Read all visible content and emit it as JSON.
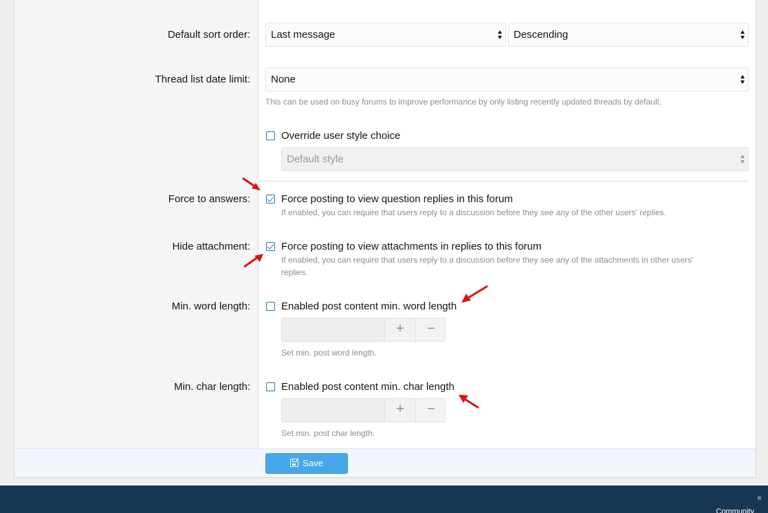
{
  "form": {
    "sort": {
      "label": "Default sort order:",
      "field_value": "Last message",
      "direction_value": "Descending"
    },
    "date_limit": {
      "label": "Thread list date limit:",
      "value": "None",
      "hint": "This can be used on busy forums to improve performance by only listing recently updated threads by default."
    },
    "style": {
      "checkbox_label": "Override user style choice",
      "checked": false,
      "select_value": "Default style"
    },
    "force_answers": {
      "label": "Force to answers:",
      "checkbox_label": "Force posting to view question replies in this forum",
      "checked": true,
      "hint": "If enabled, you can require that users reply to a discussion before they see any of the other users' replies."
    },
    "hide_attachment": {
      "label": "Hide attachment:",
      "checkbox_label": "Force posting to view attachments in replies to this forum",
      "checked": true,
      "hint_line1": "If enabled, you can require that users reply to a discussion before they see any of the attachments in other users'",
      "hint_line2": "replies."
    },
    "min_word": {
      "label": "Min. word length:",
      "checkbox_label": "Enabled post content min. word length",
      "checked": false,
      "stepper_value": "",
      "plus": "+",
      "minus": "−",
      "hint": "Set min. post word length."
    },
    "min_char": {
      "label": "Min. char length:",
      "checkbox_label": "Enabled post content min. char length",
      "checked": false,
      "stepper_value": "",
      "plus": "+",
      "minus": "−",
      "hint": "Set min. post char length."
    }
  },
  "actions": {
    "save_label": "Save"
  },
  "footer": {
    "text": "Community platform by XenForo",
    "registered": "®"
  },
  "colors": {
    "accent": "#2577b1",
    "save_button": "#47a7eb",
    "footer_bg": "#183754",
    "annotation_arrow": "#e01010"
  }
}
